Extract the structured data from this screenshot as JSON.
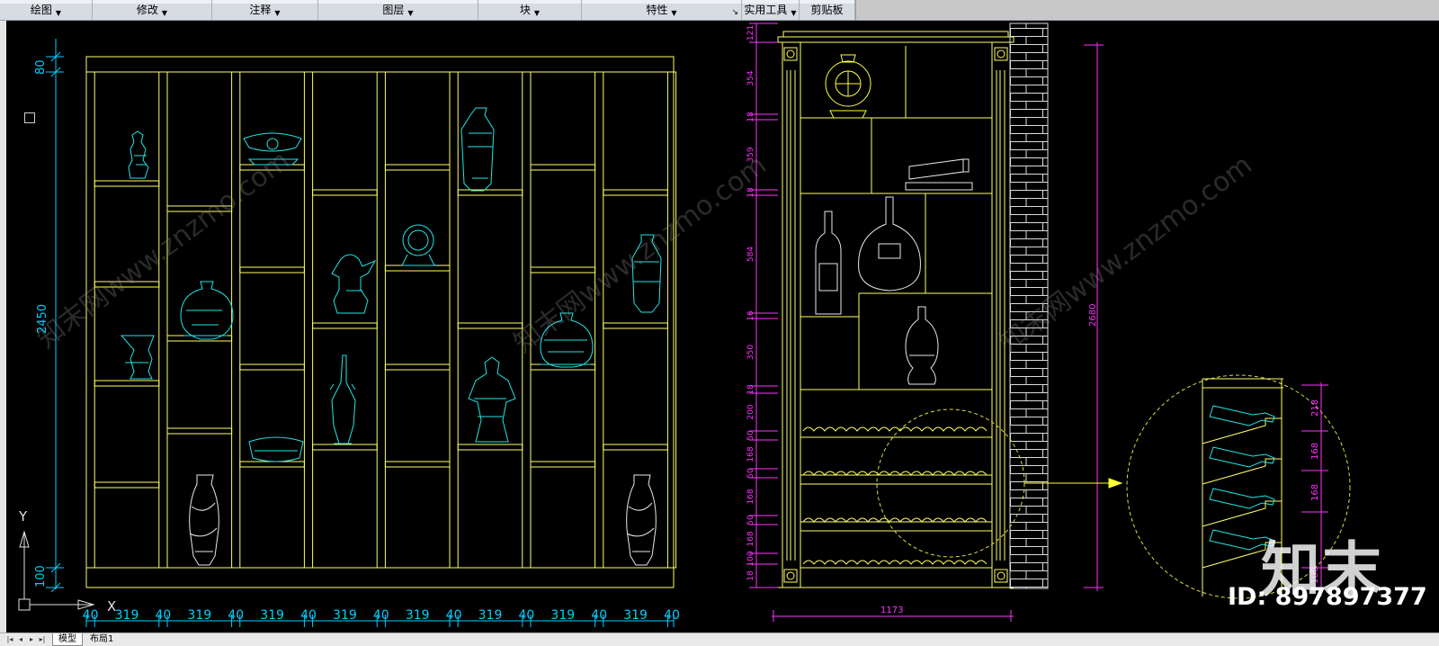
{
  "ribbon": {
    "panels": [
      {
        "label": "绘图",
        "dropdown": true
      },
      {
        "label": "修改",
        "dropdown": true
      },
      {
        "label": "注释",
        "dropdown": true
      },
      {
        "label": "图层",
        "dropdown": true
      },
      {
        "label": "块",
        "dropdown": true
      },
      {
        "label": "特性",
        "dropdown": true
      },
      {
        "label": "实用工具",
        "dropdown": true
      },
      {
        "label": "剪贴板",
        "dropdown": false
      }
    ],
    "launcher_glyph": "↘"
  },
  "drawing": {
    "left_elevation": {
      "dims_vertical": [
        "80",
        "2450",
        "100"
      ],
      "dims_horizontal": [
        "40",
        "319",
        "40",
        "319",
        "40",
        "319",
        "40",
        "319",
        "40",
        "319",
        "40",
        "319",
        "40",
        "319",
        "40",
        "319",
        "40"
      ]
    },
    "right_elevation": {
      "dims_left": [
        "121",
        "354",
        "18",
        "359",
        "18",
        "584",
        "16",
        "350",
        "18",
        "200",
        "50",
        "168",
        "50",
        "168",
        "50",
        "168",
        "100",
        "18"
      ],
      "dim_height": "2680",
      "dim_width": "1173"
    },
    "detail": {
      "dims": [
        "218",
        "168",
        "168",
        "100"
      ]
    },
    "ucs": {
      "x_label": "X",
      "y_label": "Y"
    },
    "watermark_text": "知末网www.znzmo.com",
    "colors": {
      "frame": "#ffff66",
      "objects": "#22e5e5",
      "dims_left": "#00d0ff",
      "dims_right": "#ff33ff",
      "detail_circle": "#dddd44",
      "object_white": "#e8e8e8"
    }
  },
  "watermark": {
    "logo": "知末",
    "id": "ID: 897897377"
  },
  "status": {
    "tabs": [
      "模型",
      "布局1"
    ],
    "nav": [
      "|◂",
      "◂",
      "▸",
      "▸|"
    ]
  }
}
